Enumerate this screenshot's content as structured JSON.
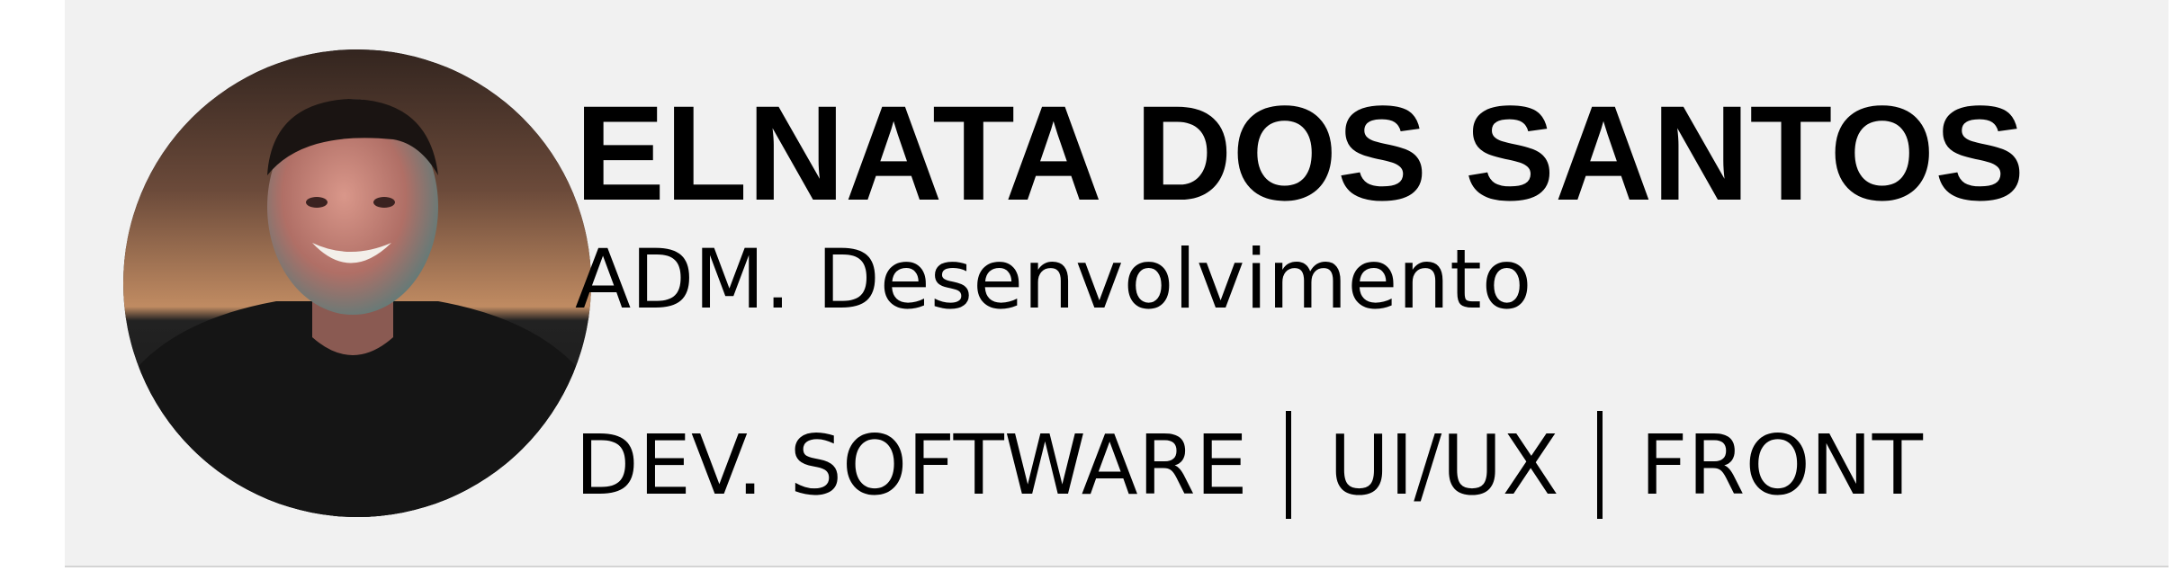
{
  "profile": {
    "name": "ELNATA DOS SANTOS",
    "role": "ADM. Desenvolvimento",
    "skills": [
      "DEV. SOFTWARE",
      "UI/UX",
      "FRONT"
    ]
  },
  "colors": {
    "card_background": "#f1f1f1",
    "text": "#000000",
    "photo_background_top": "#3b2b24",
    "photo_background_warm": "#b8845e",
    "shirt": "#151515"
  },
  "icons": {
    "avatar": "profile-photo"
  }
}
